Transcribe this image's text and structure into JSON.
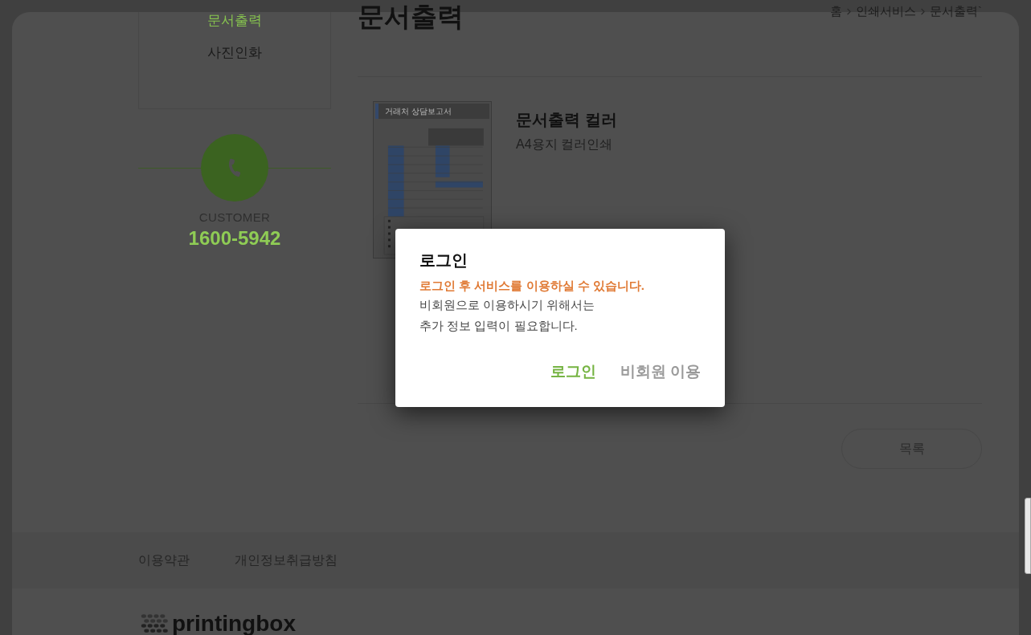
{
  "sidebar": {
    "items": [
      {
        "label": "문서출력",
        "selected": true
      },
      {
        "label": "사진인화",
        "selected": false
      }
    ],
    "customer": {
      "label": "CUSTOMER",
      "phone": "1600-5942"
    }
  },
  "page": {
    "title": "문서출력",
    "breadcrumb": [
      "홈",
      "인쇄서비스",
      "문서출력`"
    ]
  },
  "product": {
    "name": "문서출력 컬러",
    "description": "A4용지 컬러인쇄",
    "thumbnail_title": "거래처 상담보고서"
  },
  "list_button": "목록",
  "footer": {
    "links": [
      "이용약관",
      "개인정보취급방침"
    ],
    "logo": "printingbox"
  },
  "dialog": {
    "title": "로그인",
    "notice": "로그인 후 서비스를 이용하실 수 있습니다.",
    "lines": [
      "비회원으로 이용하시기 위해서는",
      "추가 정보 입력이 필요합니다."
    ],
    "buttons": [
      {
        "label": "로그인",
        "kind": "primary"
      },
      {
        "label": "비회원 이용",
        "kind": "secondary"
      }
    ]
  }
}
